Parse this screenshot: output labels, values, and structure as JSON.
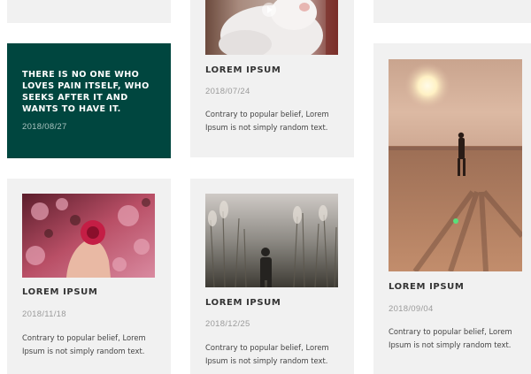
{
  "quote_card": {
    "text": "THERE IS NO ONE WHO LOVES PAIN ITSELF, WHO SEEKS AFTER IT AND WANTS TO HAVE IT.",
    "date": "2018/08/27"
  },
  "cards": {
    "cat": {
      "title": "LOREM IPSUM",
      "date": "2018/07/24",
      "desc": "Contrary to popular belief, Lorem Ipsum is not simply random text.",
      "image_icon": "cat-photo",
      "play_icon": "play-icon"
    },
    "beach": {
      "title": "LOREM IPSUM",
      "date": "2018/09/04",
      "desc": "Contrary to popular belief, Lorem Ipsum is not simply random text.",
      "image_icon": "beach-sunset-photo"
    },
    "flower": {
      "title": "LOREM IPSUM",
      "date": "2018/11/18",
      "desc": "Contrary to popular belief, Lorem Ipsum is not simply random text.",
      "image_icon": "flower-hand-photo"
    },
    "grass": {
      "title": "LOREM IPSUM",
      "date": "2018/12/25",
      "desc": "Contrary to popular belief, Lorem Ipsum is not simply random text.",
      "image_icon": "grass-photographer-photo"
    }
  },
  "colors": {
    "card_bg": "#f1f1f1",
    "quote_bg": "#00463f",
    "title": "#333333",
    "date": "#9b9b9b"
  }
}
